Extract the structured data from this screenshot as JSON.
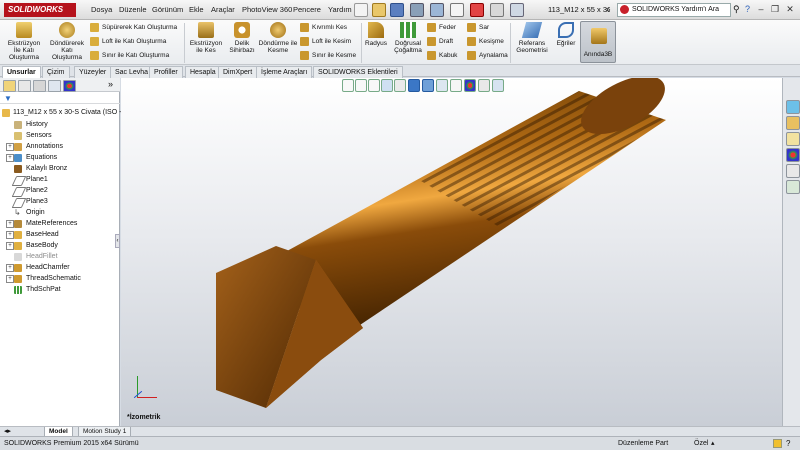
{
  "app": {
    "logo_text": "SOLIDWORKS",
    "document_title": "113_M12 x 55 x 30...",
    "help_search_placeholder": "SOLIDWORKS Yardım'ı Ara"
  },
  "menu": [
    "Dosya",
    "Düzenle",
    "Görünüm",
    "Ekle",
    "Araçlar",
    "PhotoView 360",
    "Pencere",
    "Yardım"
  ],
  "ribbon": {
    "ekstruzyon_ile_kati": "Ekstrüzyon İle Katı Oluşturma",
    "dondurerek_kati": "Döndürerek Katı Oluşturma",
    "supurerek_kati": "Süpürerek Katı Oluşturma",
    "loft_kati": "Loft ile Katı Oluşturma",
    "sinir_kati": "Sınır ile Katı Oluşturma",
    "ekstruzyon_kes": "Ekstrüzyon ile Kes",
    "delik_sihirbazi": "Delik Sihirbazı",
    "dondurme_kesme": "Döndürme ile Kesme",
    "kivrimli_kes": "Kıvrımlı Kes",
    "loft_kesim": "Loft ile Kesim",
    "sinir_kesme": "Sınır ile Kesme",
    "radyus": "Radyus",
    "dogrusal_cogaltma": "Doğrusal Çoğaltma",
    "feder": "Feder",
    "draft": "Draft",
    "kabuk": "Kabuk",
    "sar": "Sar",
    "kesisme": "Kesişme",
    "aynalama": "Aynalama",
    "referans_geometrisi": "Referans Geometrisi",
    "egriler": "Eğriler",
    "aninda3b": "Anında3B"
  },
  "tabs": [
    "Unsurlar",
    "Çizim",
    "Yüzeyler",
    "Sac Levha",
    "Profiller",
    "Hesapla",
    "DimXpert",
    "İşleme Araçları",
    "SOLIDWORKS Eklentileri"
  ],
  "tree": {
    "root": "113_M12 x 55 x 30-S Civata  (ISO -",
    "items": [
      "History",
      "Sensors",
      "Annotations",
      "Equations",
      "Kalaylı Bronz",
      "Plane1",
      "Plane2",
      "Plane3",
      "Origin",
      "MateReferences",
      "BaseHead",
      "BaseBody",
      "HeadFillet",
      "HeadChamfer",
      "ThreadSchematic",
      "ThdSchPat"
    ]
  },
  "viewport": {
    "view_label": "*İzometrik"
  },
  "model_tabs": [
    "Model",
    "Motion Study 1"
  ],
  "status": {
    "left": "SOLIDWORKS Premium 2015 x64 Sürümü",
    "mode": "Düzenleme Part",
    "units": "Özel"
  },
  "colors": {
    "bolt_light": "#f0a840",
    "bolt_dark": "#5a3000",
    "logo_red": "#b5121b"
  }
}
